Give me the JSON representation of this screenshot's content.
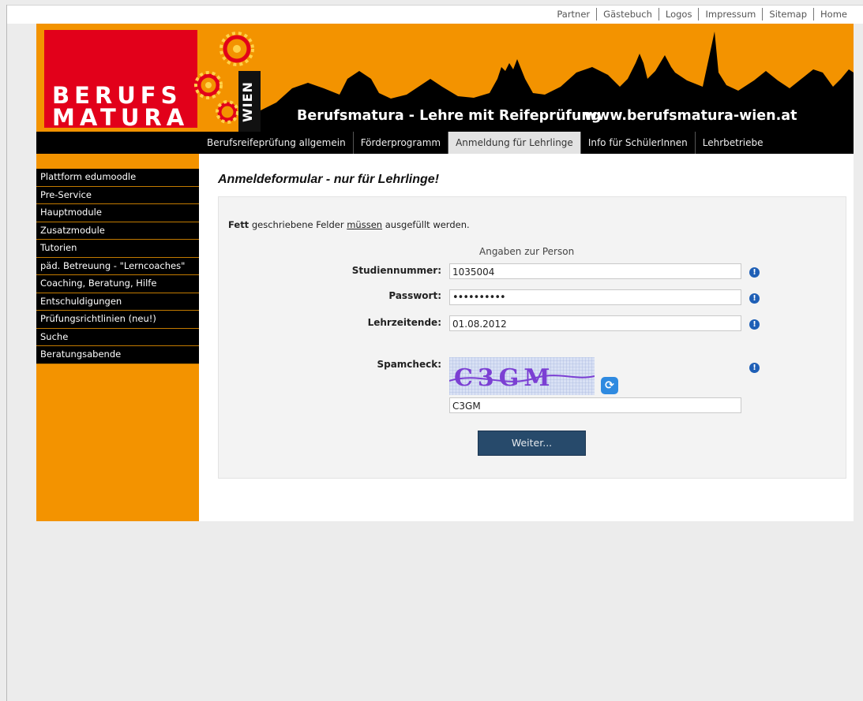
{
  "top_links": [
    "Partner",
    "Gästebuch",
    "Logos",
    "Impressum",
    "Sitemap",
    "Home"
  ],
  "header": {
    "logo_line1": "BERUFS",
    "logo_line2": "MATURA",
    "city": "WIEN",
    "slogan": "Berufsmatura - Lehre mit Reifeprüfung",
    "site_url": "www.berufsmatura-wien.at"
  },
  "main_nav": [
    {
      "label": "Berufsreifeprüfung allgemein",
      "active": false
    },
    {
      "label": "Förderprogramm",
      "active": false
    },
    {
      "label": "Anmeldung für Lehrlinge",
      "active": true
    },
    {
      "label": "Info für SchülerInnen",
      "active": false
    },
    {
      "label": "Lehrbetriebe",
      "active": false
    }
  ],
  "sidebar": [
    "Plattform edumoodle",
    "Pre-Service",
    "Hauptmodule",
    "Zusatzmodule",
    "Tutorien",
    "päd. Betreuung - \"Lerncoaches\"",
    "Coaching, Beratung, Hilfe",
    "Entschuldigungen",
    "Prüfungsrichtlinien (neu!)",
    "Suche",
    "Beratungsabende"
  ],
  "form": {
    "heading": "Anmeldeformular - nur für Lehrlinge!",
    "intro_bold": "Fett",
    "intro_text1": " geschriebene Felder ",
    "intro_underline": "müssen",
    "intro_text2": " ausgefüllt werden.",
    "section_title": "Angaben zur Person",
    "studiennummer_label": "Studiennummer:",
    "studiennummer_value": "1035004",
    "passwort_label": "Passwort:",
    "passwort_value": "••••••••••",
    "lehrzeitende_label": "Lehrzeitende:",
    "lehrzeitende_value": "01.08.2012",
    "spamcheck_label": "Spamcheck:",
    "captcha_text": "C3GM",
    "captcha_input": "C3GM",
    "submit_label": "Weiter..."
  },
  "colors": {
    "orange": "#f39300",
    "red": "#e2001a",
    "nav_black": "#000000",
    "button_blue": "#274a6b",
    "info_blue": "#1e5fb6"
  }
}
